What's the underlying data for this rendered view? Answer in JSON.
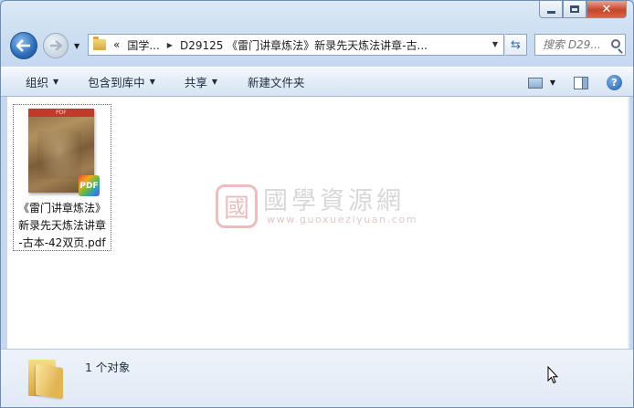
{
  "nav": {
    "breadcrumbs": [
      "«",
      "国学...",
      "D29125 《雷门讲章炼法》新录先天炼法讲章-古..."
    ],
    "search_placeholder": "搜索 D29..."
  },
  "toolbar": {
    "organize": "组织",
    "include_in_library": "包含到库中",
    "share": "共享",
    "new_folder": "新建文件夹"
  },
  "file": {
    "name": "《雷门讲章炼法》新录先天炼法讲章-古本-42双页.pdf",
    "name_lines": [
      "《雷门讲章炼法》",
      "新录先天炼法讲章",
      "-古本-42双页.pdf"
    ],
    "badge": "PDF",
    "thumb_mark": "PDF"
  },
  "watermark": {
    "title": "國學資源網",
    "url": "www.guoxueziyuan.com",
    "seal": "國"
  },
  "details": {
    "count": "1 个对象"
  },
  "colors": {
    "accent": "#2b6bb8",
    "window_frame": "#c5d8ef",
    "close_button": "#c4462a"
  }
}
